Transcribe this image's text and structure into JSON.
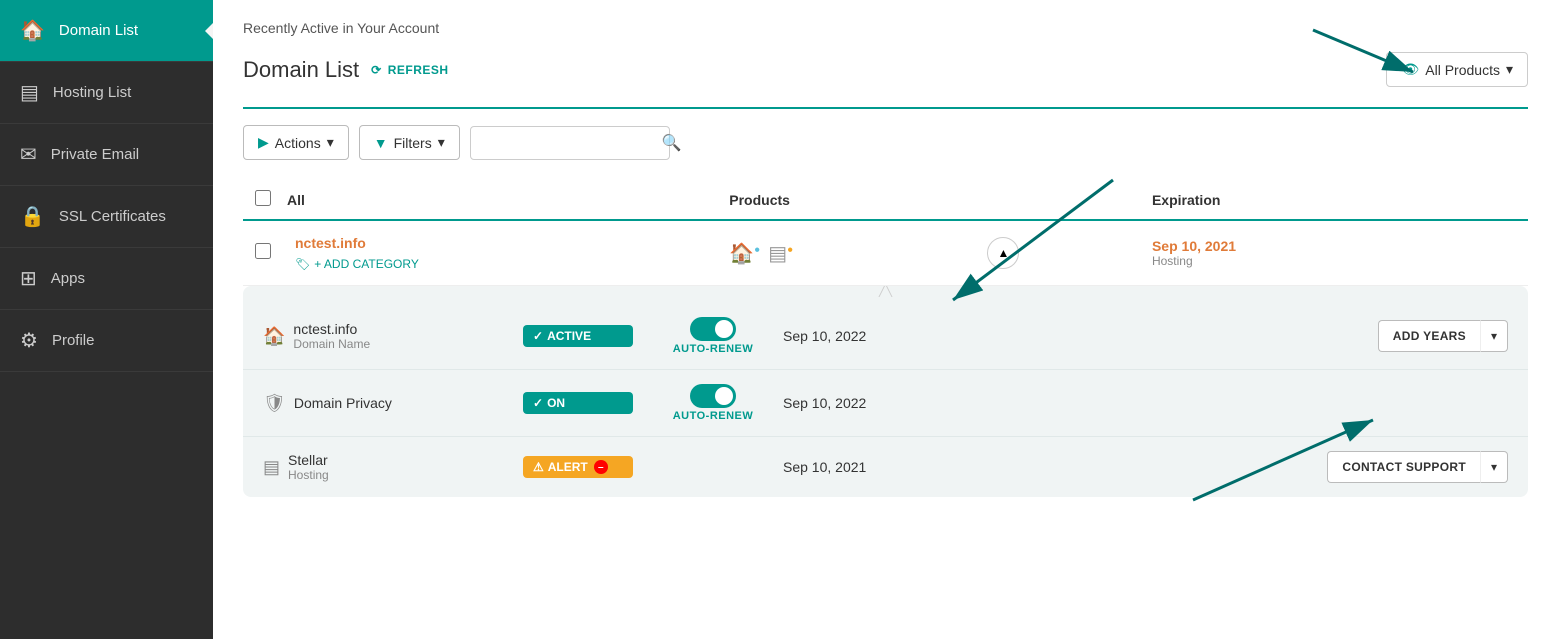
{
  "sidebar": {
    "items": [
      {
        "id": "domain-list",
        "label": "Domain List",
        "icon": "🏠",
        "active": true
      },
      {
        "id": "hosting-list",
        "label": "Hosting List",
        "icon": "☰",
        "active": false
      },
      {
        "id": "private-email",
        "label": "Private Email",
        "icon": "✉",
        "active": false
      },
      {
        "id": "ssl-certificates",
        "label": "SSL Certificates",
        "icon": "🔒",
        "active": false
      },
      {
        "id": "apps",
        "label": "Apps",
        "icon": "⊞",
        "active": false
      },
      {
        "id": "profile",
        "label": "Profile",
        "icon": "⚙",
        "active": false
      }
    ]
  },
  "header": {
    "recently_active": "Recently Active in Your Account",
    "title": "Domain List",
    "refresh_label": "REFRESH",
    "all_products_label": "All Products"
  },
  "toolbar": {
    "actions_label": "Actions",
    "filters_label": "Filters",
    "search_placeholder": ""
  },
  "table": {
    "columns": [
      "All",
      "Products",
      "",
      "Expiration"
    ],
    "domain": {
      "name": "nctest.info",
      "add_category": "+ ADD CATEGORY",
      "expiration": "Sep 10, 2021",
      "expiration_sub": "Hosting"
    },
    "expanded": [
      {
        "name": "nctest.info",
        "sub": "Domain Name",
        "status": "✓ ACTIVE",
        "status_type": "active",
        "auto_renew": true,
        "auto_renew_label": "AUTO-RENEW",
        "expiration": "Sep 10, 2022",
        "action_main": "ADD YEARS",
        "action_type": "normal"
      },
      {
        "name": "Domain Privacy",
        "sub": "",
        "status": "✓ ON",
        "status_type": "on",
        "auto_renew": true,
        "auto_renew_label": "AUTO-RENEW",
        "expiration": "Sep 10, 2022",
        "action_main": "",
        "action_type": "none"
      }
    ],
    "stellar": {
      "name": "Stellar",
      "sub": "Hosting",
      "status": "⚠ ALERT",
      "status_type": "alert",
      "expiration": "Sep 10, 2021",
      "action_main": "CONTACT SUPPORT",
      "action_type": "normal"
    }
  }
}
